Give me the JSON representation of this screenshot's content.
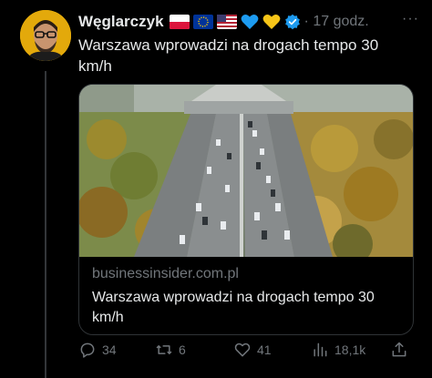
{
  "tweet": {
    "author_name": "Węglarczyk",
    "emojis": [
      "flag-poland",
      "flag-eu",
      "flag-usa",
      "blue-heart",
      "yellow-heart"
    ],
    "verified": true,
    "time": "· 17 godz.",
    "more_label": "···",
    "text": "Warszawa wprowadzi na drogach tempo 30 km/h"
  },
  "card": {
    "domain": "businessinsider.com.pl",
    "title": "Warszawa wprowadzi na drogach tempo 30 km/h"
  },
  "actions": {
    "replies": "34",
    "retweets": "6",
    "likes": "41",
    "views": "18,1k"
  },
  "colors": {
    "background": "#000000",
    "text": "#e7e9ea",
    "muted": "#71767b",
    "verified": "#1d9bf0",
    "border": "#2f3336"
  }
}
